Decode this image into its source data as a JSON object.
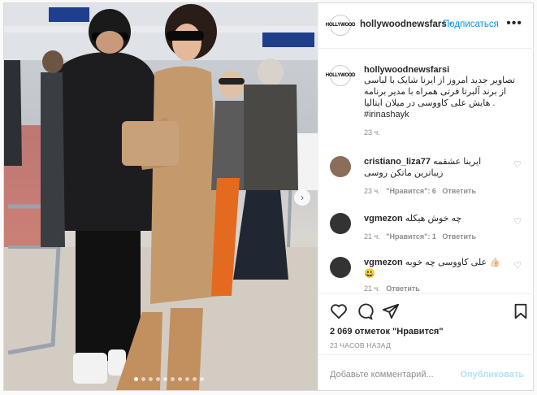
{
  "post": {
    "username": "hollywoodnewsfars",
    "follow_label": "Подписаться",
    "more_label": "•••",
    "avatar_text": "HOLLYWOOD"
  },
  "caption": {
    "username": "hollywoodnewsfarsi",
    "text_line1": "تصاویر جدید امروز از ایرنا شایک با لباسی",
    "text_line2": "از برند آلبرتا فرتی همراه با مدیر برنامه",
    "text_line3": "هایش علی کاووسی در میلان ایتالیا .",
    "hashtag": "#irinashayk",
    "time": "23 ч."
  },
  "comments": [
    {
      "username": "cristiano_liza77",
      "text": "ایرینا عشقمه",
      "text2": "زیباترین ماتکن روسی",
      "time": "23 ч.",
      "likes": "\"Нравится\": 6",
      "reply": "Ответить"
    },
    {
      "username": "vgmezon",
      "text": "چه خوش هیکله",
      "time": "21 ч.",
      "likes": "\"Нравится\": 1",
      "reply": "Ответить"
    },
    {
      "username": "vgmezon",
      "text": "علی کاووسی چه خوبه 👍🏻",
      "emoji": "😃",
      "time": "21 ч.",
      "reply": "Ответить"
    }
  ],
  "actions": {
    "likes": "2 069 отметок \"Нравится\"",
    "date": "23 ЧАСОВ НАЗАД"
  },
  "add_comment": {
    "placeholder": "Добавьте комментарий...",
    "publish": "Опубликовать"
  },
  "icons": [
    "heart-icon",
    "comment-icon",
    "share-icon",
    "bookmark-icon",
    "chevron-right-icon"
  ],
  "colors": {
    "accent": "#0095f6",
    "muted": "#8e8e8e",
    "publish_disabled": "#b2dffc"
  }
}
